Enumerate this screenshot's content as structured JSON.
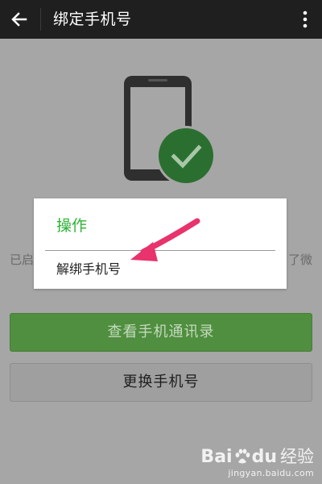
{
  "header": {
    "title": "绑定手机号",
    "back_icon": "arrow-left-icon",
    "more_icon": "more-vertical-icon"
  },
  "illustration": {
    "icon": "phone-check-icon"
  },
  "description": {
    "left_text": "已启",
    "right_text": "了微"
  },
  "buttons": {
    "view_contacts": "查看手机通讯录",
    "change_phone": "更换手机号"
  },
  "dialog": {
    "title": "操作",
    "items": [
      {
        "label": "解绑手机号"
      }
    ]
  },
  "colors": {
    "accent_green": "#2db235",
    "arrow_pink": "#e8336c",
    "header_bg": "#1f1f1f"
  },
  "watermark": {
    "logo_text_1": "Bai",
    "logo_text_2": "du",
    "logo_text_3": "经验",
    "url": "jingyan.baidu.com"
  }
}
